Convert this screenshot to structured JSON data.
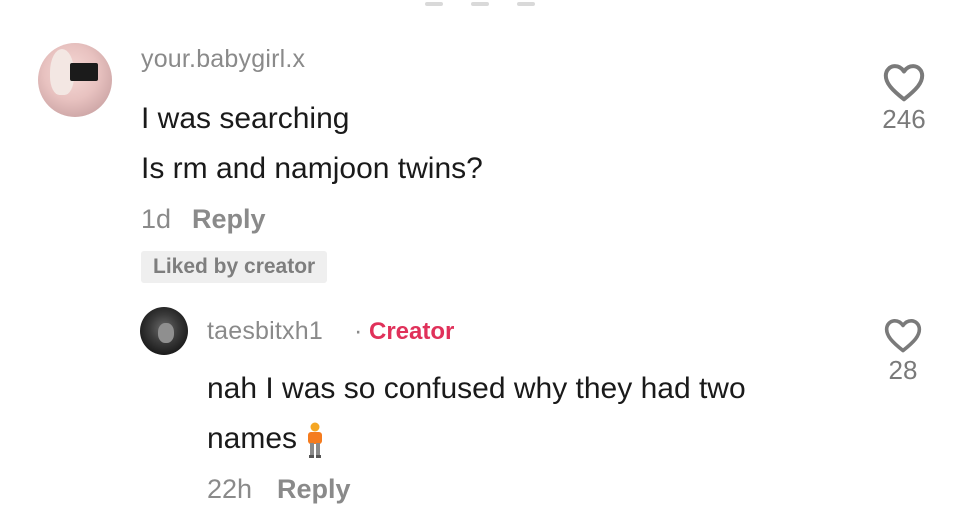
{
  "comments": [
    {
      "username": "your.babygirl.x",
      "lines": [
        "I was searching",
        "Is rm and namjoon twins?"
      ],
      "time": "1d",
      "reply_label": "Reply",
      "badge": "Liked by creator",
      "like_count": "246"
    }
  ],
  "replies": [
    {
      "username": "taesbitxh1",
      "separator": "·",
      "creator_label": "Creator",
      "lines": [
        "nah I was so confused why they had two",
        "names"
      ],
      "emoji": "person-standing-emoji",
      "time": "22h",
      "reply_label": "Reply",
      "like_count": "28"
    }
  ],
  "colors": {
    "creator": "#e0315a",
    "muted": "#8a8a8a",
    "text": "#1a1a1a",
    "badge_bg": "#efefef"
  },
  "icons": {
    "like": "heart-outline-icon"
  }
}
